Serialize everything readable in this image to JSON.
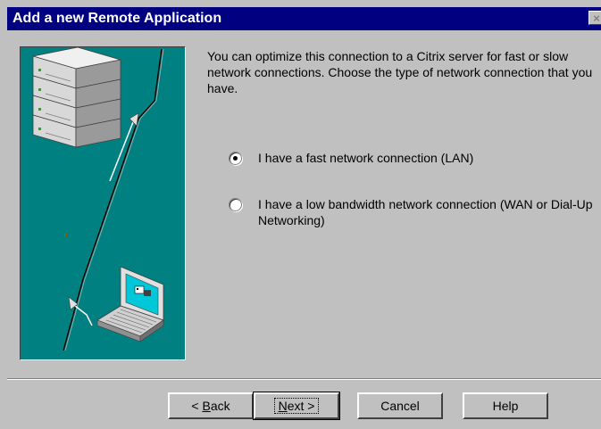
{
  "window": {
    "title": "Add a new Remote Application",
    "close_glyph": "×"
  },
  "intro_text": "You can optimize this connection to a Citrix server for fast or slow network connections.  Choose the type of network connection that you have.",
  "options": [
    {
      "label": "I have a fast network connection (LAN)",
      "checked": true
    },
    {
      "label": "I have a low bandwidth network connection (WAN or Dial-Up Networking)",
      "checked": false
    }
  ],
  "buttons": {
    "back": {
      "prefix": "< ",
      "mnemonic": "B",
      "rest": "ack"
    },
    "next": {
      "mnemonic": "N",
      "rest": "ext >"
    },
    "cancel": "Cancel",
    "help": "Help"
  },
  "illustration": {
    "icons": [
      "server-stack-icon",
      "laptop-icon",
      "network-cable-icon"
    ],
    "background_color": "#008080"
  }
}
